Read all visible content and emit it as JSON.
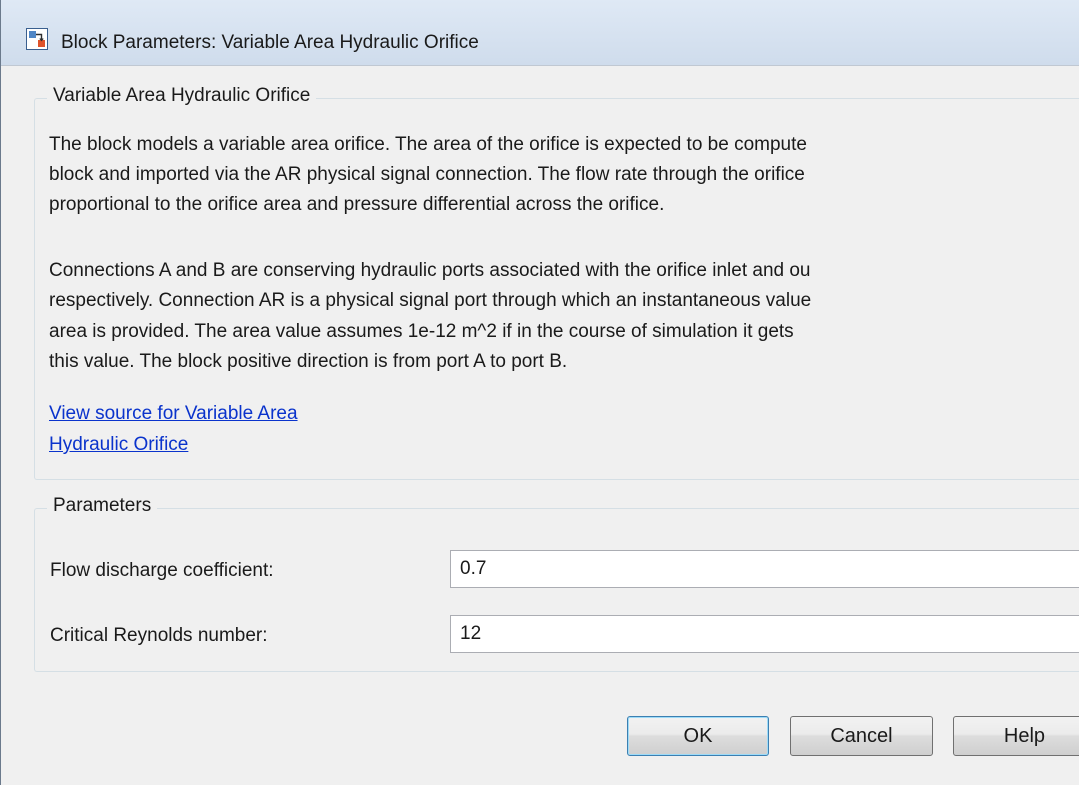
{
  "window": {
    "title": "Block Parameters: Variable Area Hydraulic Orifice"
  },
  "description_group": {
    "legend": "Variable Area Hydraulic Orifice",
    "paragraph1": [
      "The block models a variable area orifice. The area of the orifice is expected to be compute",
      "block and imported via the AR physical signal connection. The flow rate through the orifice",
      "proportional to the orifice area and pressure differential across the orifice."
    ],
    "paragraph2": [
      "Connections A and B are conserving hydraulic ports associated with the orifice inlet and ou",
      "respectively. Connection AR is a physical signal port through which an instantaneous value",
      "area is provided. The area value assumes 1e-12 m^2 if in the course of simulation it gets",
      "this value. The block positive direction is from port A to port B."
    ],
    "source_link": [
      "View source for Variable Area",
      "Hydraulic Orifice"
    ]
  },
  "parameters_group": {
    "legend": "Parameters",
    "fields": [
      {
        "label": "Flow discharge coefficient:",
        "value": "0.7"
      },
      {
        "label": "Critical Reynolds number:",
        "value": "12"
      }
    ]
  },
  "buttons": {
    "ok": "OK",
    "cancel": "Cancel",
    "help": "Help"
  },
  "colors": {
    "link": "#0a33cc",
    "default_button_border": "#3c7fb1"
  },
  "icons": {
    "title": "simulink-block-icon"
  }
}
